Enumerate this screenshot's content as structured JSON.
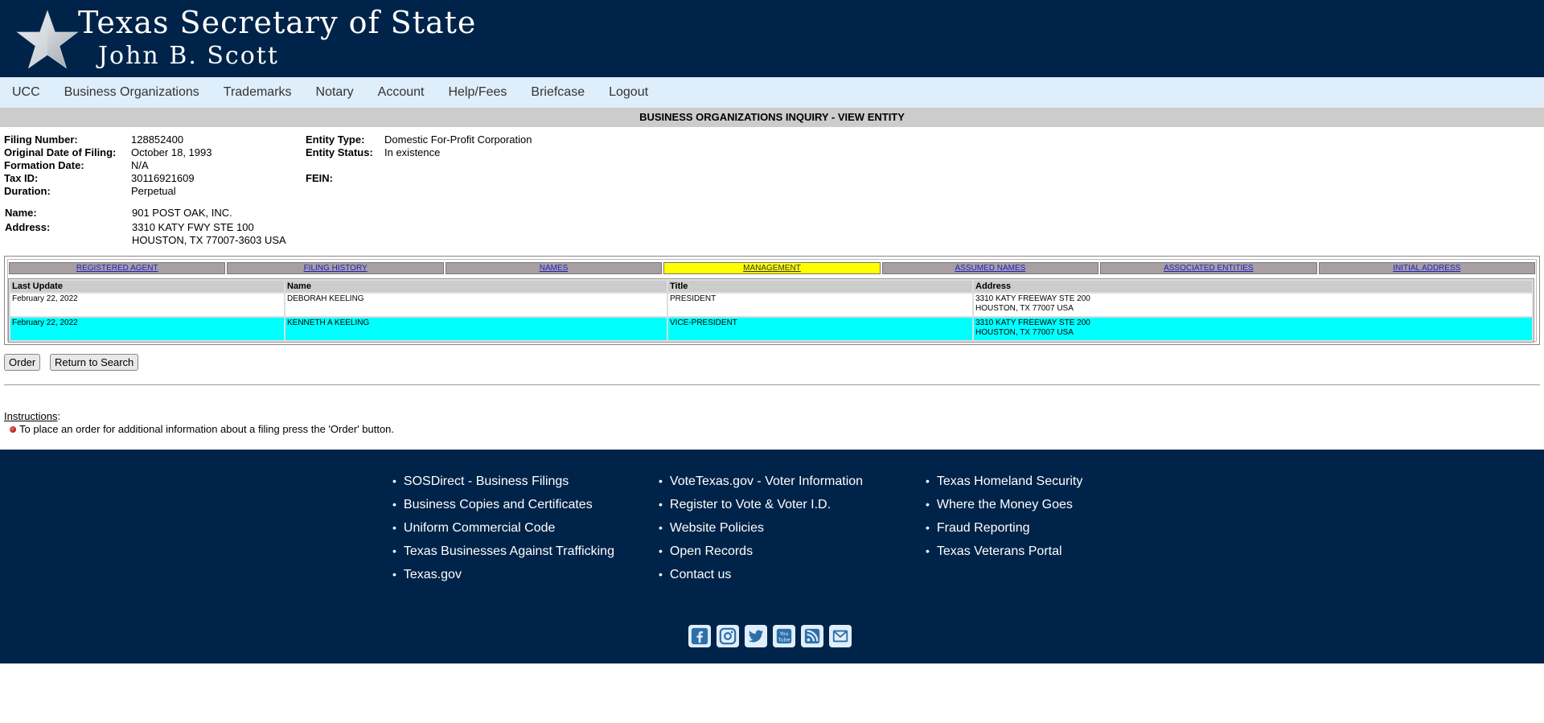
{
  "header": {
    "title": "Texas Secretary of State",
    "official": "John B. Scott"
  },
  "nav": [
    "UCC",
    "Business Organizations",
    "Trademarks",
    "Notary",
    "Account",
    "Help/Fees",
    "Briefcase",
    "Logout"
  ],
  "page_heading": "BUSINESS ORGANIZATIONS INQUIRY - VIEW ENTITY",
  "entity": {
    "filing_number_label": "Filing Number:",
    "filing_number": "128852400",
    "original_date_label": "Original Date of Filing:",
    "original_date": "October 18, 1993",
    "formation_date_label": "Formation Date:",
    "formation_date": "N/A",
    "tax_id_label": "Tax ID:",
    "tax_id": "30116921609",
    "duration_label": "Duration:",
    "duration": "Perpetual",
    "entity_type_label": "Entity Type:",
    "entity_type": "Domestic For-Profit Corporation",
    "entity_status_label": "Entity Status:",
    "entity_status": "In existence",
    "fein_label": "FEIN:",
    "name_label": "Name:",
    "name": "901 POST OAK, INC.",
    "address_label": "Address:",
    "address_line1": "3310 KATY FWY STE 100",
    "address_line2": "HOUSTON, TX 77007-3603 USA"
  },
  "tabs": [
    {
      "label": "REGISTERED AGENT",
      "active": false
    },
    {
      "label": "FILING HISTORY",
      "active": false
    },
    {
      "label": "NAMES",
      "active": false
    },
    {
      "label": "MANAGEMENT",
      "active": true
    },
    {
      "label": "ASSUMED NAMES",
      "active": false
    },
    {
      "label": "ASSOCIATED ENTITIES",
      "active": false
    },
    {
      "label": "INITIAL ADDRESS",
      "active": false
    }
  ],
  "management": {
    "columns": [
      "Last Update",
      "Name",
      "Title",
      "Address"
    ],
    "rows": [
      {
        "last_update": "February 22, 2022",
        "name": "DEBORAH KEELING",
        "title": "PRESIDENT",
        "address1": "3310 KATY FREEWAY STE 200",
        "address2": "HOUSTON, TX 77007 USA"
      },
      {
        "last_update": "February 22, 2022",
        "name": "KENNETH A KEELING",
        "title": "VICE-PRESIDENT",
        "address1": "3310 KATY FREEWAY STE 200",
        "address2": "HOUSTON, TX 77007 USA"
      }
    ]
  },
  "buttons": {
    "order": "Order",
    "return": "Return to Search"
  },
  "instructions": {
    "title": "Instructions",
    "item": "To place an order for additional information about a filing press the 'Order' button."
  },
  "footer": {
    "col1": [
      "SOSDirect - Business Filings",
      "Business Copies and Certificates",
      "Uniform Commercial Code",
      "Texas Businesses Against Trafficking",
      "Texas.gov"
    ],
    "col2": [
      "VoteTexas.gov - Voter Information",
      "Register to Vote & Voter I.D.",
      "Website Policies",
      "Open Records",
      "Contact us"
    ],
    "col3": [
      "Texas Homeland Security",
      "Where the Money Goes",
      "Fraud Reporting",
      "Texas Veterans Portal"
    ],
    "social_icons": [
      "facebook-icon",
      "instagram-icon",
      "twitter-icon",
      "youtube-icon",
      "rss-icon",
      "email-icon"
    ]
  },
  "colors": {
    "header_bg": "#002449",
    "nav_bg": "#dfeefb",
    "active_tab": "#ffff00",
    "alt_row": "#00ffff"
  }
}
